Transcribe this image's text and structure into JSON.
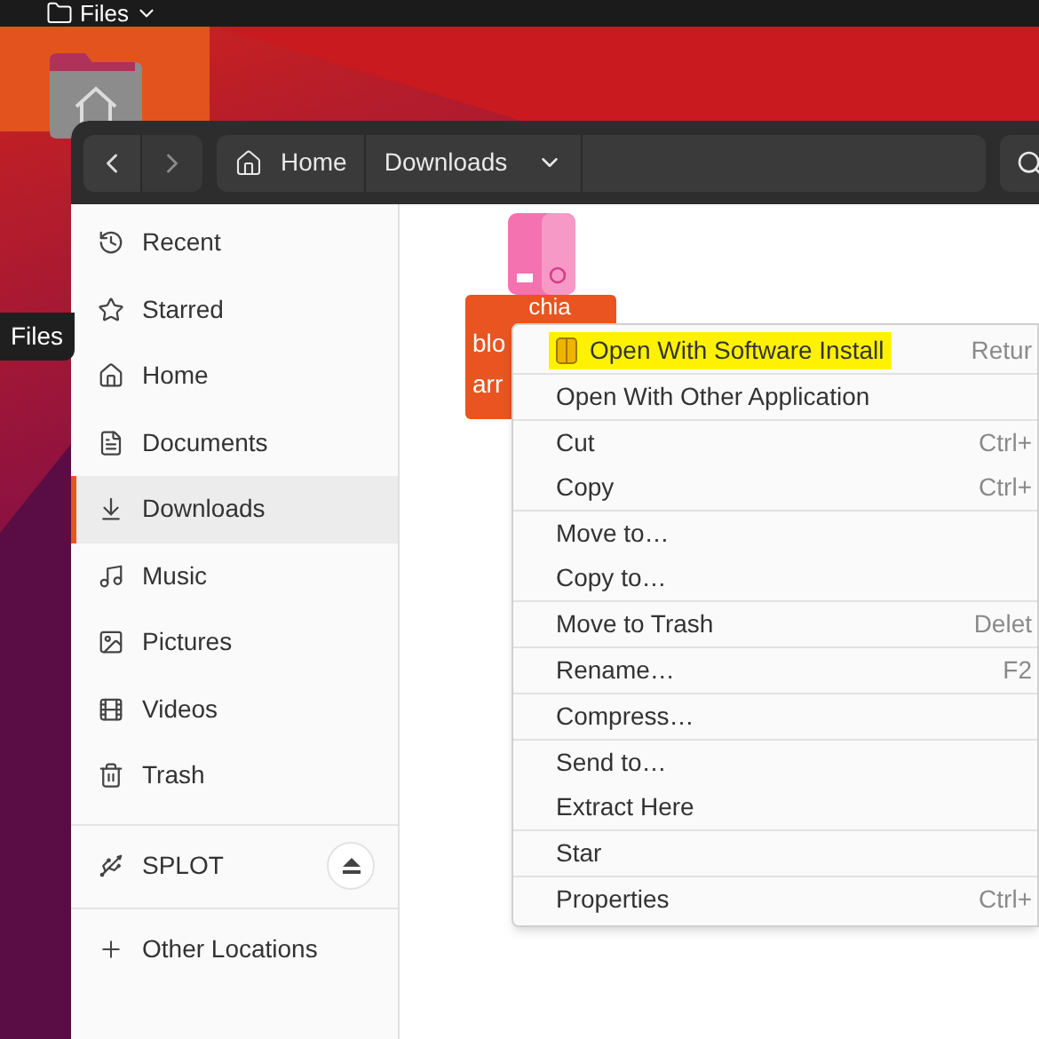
{
  "top_bar": {
    "app_label": "Files"
  },
  "tooltip": {
    "label": "Files"
  },
  "header": {
    "path": [
      {
        "label": "Home",
        "kind": "home"
      },
      {
        "label": "Downloads",
        "kind": "current"
      }
    ]
  },
  "sidebar": {
    "places": [
      {
        "label": "Recent",
        "kind": "recent",
        "selected": false
      },
      {
        "label": "Starred",
        "kind": "starred",
        "selected": false
      },
      {
        "label": "Home",
        "kind": "home",
        "selected": false
      },
      {
        "label": "Documents",
        "kind": "documents",
        "selected": false
      },
      {
        "label": "Downloads",
        "kind": "downloads",
        "selected": true
      },
      {
        "label": "Music",
        "kind": "music",
        "selected": false
      },
      {
        "label": "Pictures",
        "kind": "pictures",
        "selected": false
      },
      {
        "label": "Videos",
        "kind": "videos",
        "selected": false
      },
      {
        "label": "Trash",
        "kind": "trash",
        "selected": false
      }
    ],
    "devices": [
      {
        "label": "SPLOT",
        "ejectable": true
      }
    ],
    "other": {
      "label": "Other Locations"
    }
  },
  "files": [
    {
      "name_lines": [
        "chia",
        "blo",
        "arr"
      ],
      "selected": true
    }
  ],
  "context_menu": {
    "groups": [
      [
        {
          "label": "Open With Software Install",
          "shortcut": "Retur",
          "highlighted": true
        }
      ],
      [
        {
          "label": "Open With Other Application",
          "highlighted": false
        }
      ],
      [
        {
          "label": "Cut",
          "shortcut": "Ctrl+",
          "highlighted": false
        },
        {
          "label": "Copy",
          "shortcut": "Ctrl+",
          "highlighted": false
        }
      ],
      [
        {
          "label": "Move to…",
          "highlighted": false
        },
        {
          "label": "Copy to…",
          "highlighted": false
        }
      ],
      [
        {
          "label": "Move to Trash",
          "shortcut": "Delet",
          "highlighted": false
        }
      ],
      [
        {
          "label": "Rename…",
          "shortcut": "F2",
          "highlighted": false
        }
      ],
      [
        {
          "label": "Compress…",
          "highlighted": false
        }
      ],
      [
        {
          "label": "Send to…",
          "highlighted": false
        },
        {
          "label": "Extract Here",
          "highlighted": false
        }
      ],
      [
        {
          "label": "Star",
          "highlighted": false
        }
      ],
      [
        {
          "label": "Properties",
          "shortcut": "Ctrl+",
          "highlighted": false
        }
      ]
    ]
  }
}
